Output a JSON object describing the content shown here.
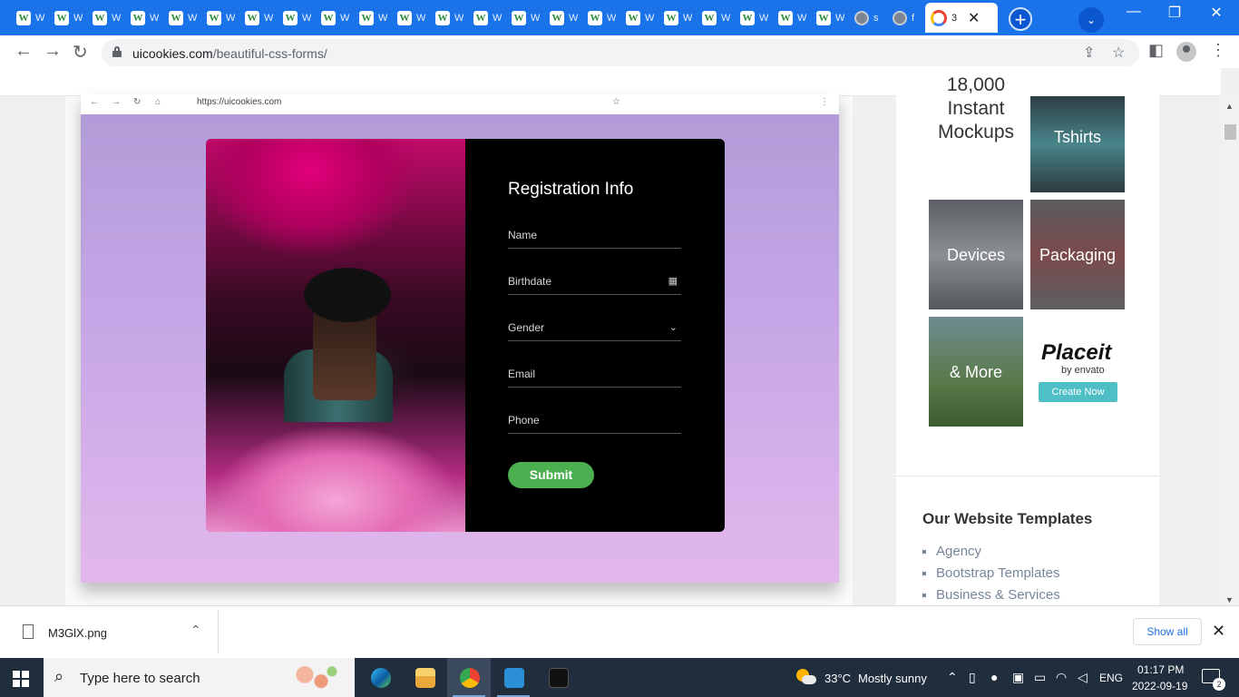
{
  "browser": {
    "tabs": [
      {
        "title": "W",
        "fav": "W"
      },
      {
        "title": "W",
        "fav": "W"
      },
      {
        "title": "W",
        "fav": "W"
      },
      {
        "title": "W",
        "fav": "W"
      },
      {
        "title": "W",
        "fav": "W"
      },
      {
        "title": "W",
        "fav": "W"
      },
      {
        "title": "W",
        "fav": "W"
      },
      {
        "title": "W",
        "fav": "W"
      },
      {
        "title": "W",
        "fav": "W"
      },
      {
        "title": "W",
        "fav": "W"
      },
      {
        "title": "W",
        "fav": "W"
      },
      {
        "title": "W",
        "fav": "W"
      },
      {
        "title": "W",
        "fav": "W"
      },
      {
        "title": "W",
        "fav": "W"
      },
      {
        "title": "W",
        "fav": "W"
      },
      {
        "title": "W",
        "fav": "W"
      },
      {
        "title": "W",
        "fav": "W"
      },
      {
        "title": "W",
        "fav": "W"
      },
      {
        "title": "W",
        "fav": "W"
      },
      {
        "title": "W",
        "fav": "W"
      },
      {
        "title": "W",
        "fav": "W"
      },
      {
        "title": "W",
        "fav": "W"
      },
      {
        "title": "s",
        "fav": "globe"
      },
      {
        "title": "f",
        "fav": "globe"
      }
    ],
    "active_tab": {
      "title": "3",
      "close": "✕"
    },
    "new_tab_label": "+",
    "tab_search_label": "⌄",
    "window_controls": {
      "minimize": "—",
      "restore": "❐",
      "close": "✕"
    },
    "nav": {
      "back": "←",
      "forward": "→",
      "reload": "↻"
    },
    "url_host": "uicookies.com",
    "url_path": "/beautiful-css-forms/",
    "toolbar_icons": {
      "share": "⇪",
      "bookmark": "☆",
      "side_panel": "◧",
      "menu": "⋮"
    }
  },
  "article": {
    "inner_browser": {
      "url": "https://uicookies.com",
      "nav_icons": [
        "←",
        "→",
        "↻",
        "⌂"
      ],
      "star": "☆",
      "menu": "⋮"
    },
    "form": {
      "title": "Registration Info",
      "fields": [
        {
          "label": "Name",
          "icon": ""
        },
        {
          "label": "Birthdate",
          "icon": "▦"
        },
        {
          "label": "Gender",
          "icon": "⌄"
        },
        {
          "label": "Email",
          "icon": ""
        },
        {
          "label": "Phone",
          "icon": ""
        }
      ],
      "submit_label": "Submit",
      "submit_color": "#4caf50"
    }
  },
  "sidebar": {
    "ad": {
      "mockups": "18,000 Instant Mockups",
      "tiles": [
        "Tshirts",
        "Devices",
        "Packaging",
        "& More"
      ],
      "brand": "Placeit",
      "brand_by": "by envato",
      "cta": "Create Now",
      "cta_color": "#4fbfc6"
    },
    "templates_title": "Our Website Templates",
    "templates": [
      "Agency",
      "Bootstrap Templates",
      "Business & Services"
    ]
  },
  "downloads": {
    "file_name": "M3GlX.png",
    "show_all": "Show all",
    "close": "✕",
    "chevron": "⌃"
  },
  "taskbar": {
    "search_placeholder": "Type here to search",
    "apps": [
      "edge",
      "file-explorer",
      "chrome",
      "vscode",
      "terminal"
    ],
    "weather_temp": "33°C",
    "weather_desc": "Mostly sunny",
    "language": "ENG",
    "time": "01:17 PM",
    "date": "2022-09-19",
    "notification_count": "2"
  }
}
